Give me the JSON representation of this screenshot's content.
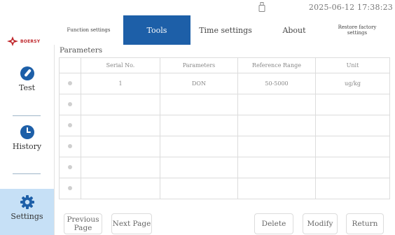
{
  "status_bar": {
    "datetime": "2025-06-12 17:38:23",
    "usb_icon": "usb-drive-icon"
  },
  "sidebar": {
    "logo_text": "BOERSY",
    "items": [
      {
        "label": "Test",
        "icon": "test-tube-icon",
        "active": false
      },
      {
        "label": "History",
        "icon": "clock-icon",
        "active": false
      },
      {
        "label": "Settings",
        "icon": "gear-icon",
        "active": true
      }
    ]
  },
  "tabs": [
    {
      "label": "Function settings",
      "active": false
    },
    {
      "label": "Tools",
      "active": true
    },
    {
      "label": "Time settings",
      "active": false
    },
    {
      "label": "About",
      "active": false
    },
    {
      "label": "Restore factory settings",
      "active": false
    }
  ],
  "section_title": "Parameters",
  "table": {
    "headers": [
      "",
      "Serial No.",
      "Parameters",
      "Reference Range",
      "Unit"
    ],
    "rows": [
      [
        "",
        "1",
        "DON",
        "50-5000",
        "ug/kg"
      ],
      [
        "",
        "",
        "",
        "",
        ""
      ],
      [
        "",
        "",
        "",
        "",
        ""
      ],
      [
        "",
        "",
        "",
        "",
        ""
      ],
      [
        "",
        "",
        "",
        "",
        ""
      ],
      [
        "",
        "",
        "",
        "",
        ""
      ]
    ]
  },
  "buttons": {
    "previous": "Previous Page",
    "next": "Next Page",
    "delete": "Delete",
    "modify": "Modify",
    "return": "Return"
  },
  "colors": {
    "accent": "#1d5fa8",
    "sidebar_active": "#c6e0f6",
    "logo_red": "#c0282d"
  }
}
